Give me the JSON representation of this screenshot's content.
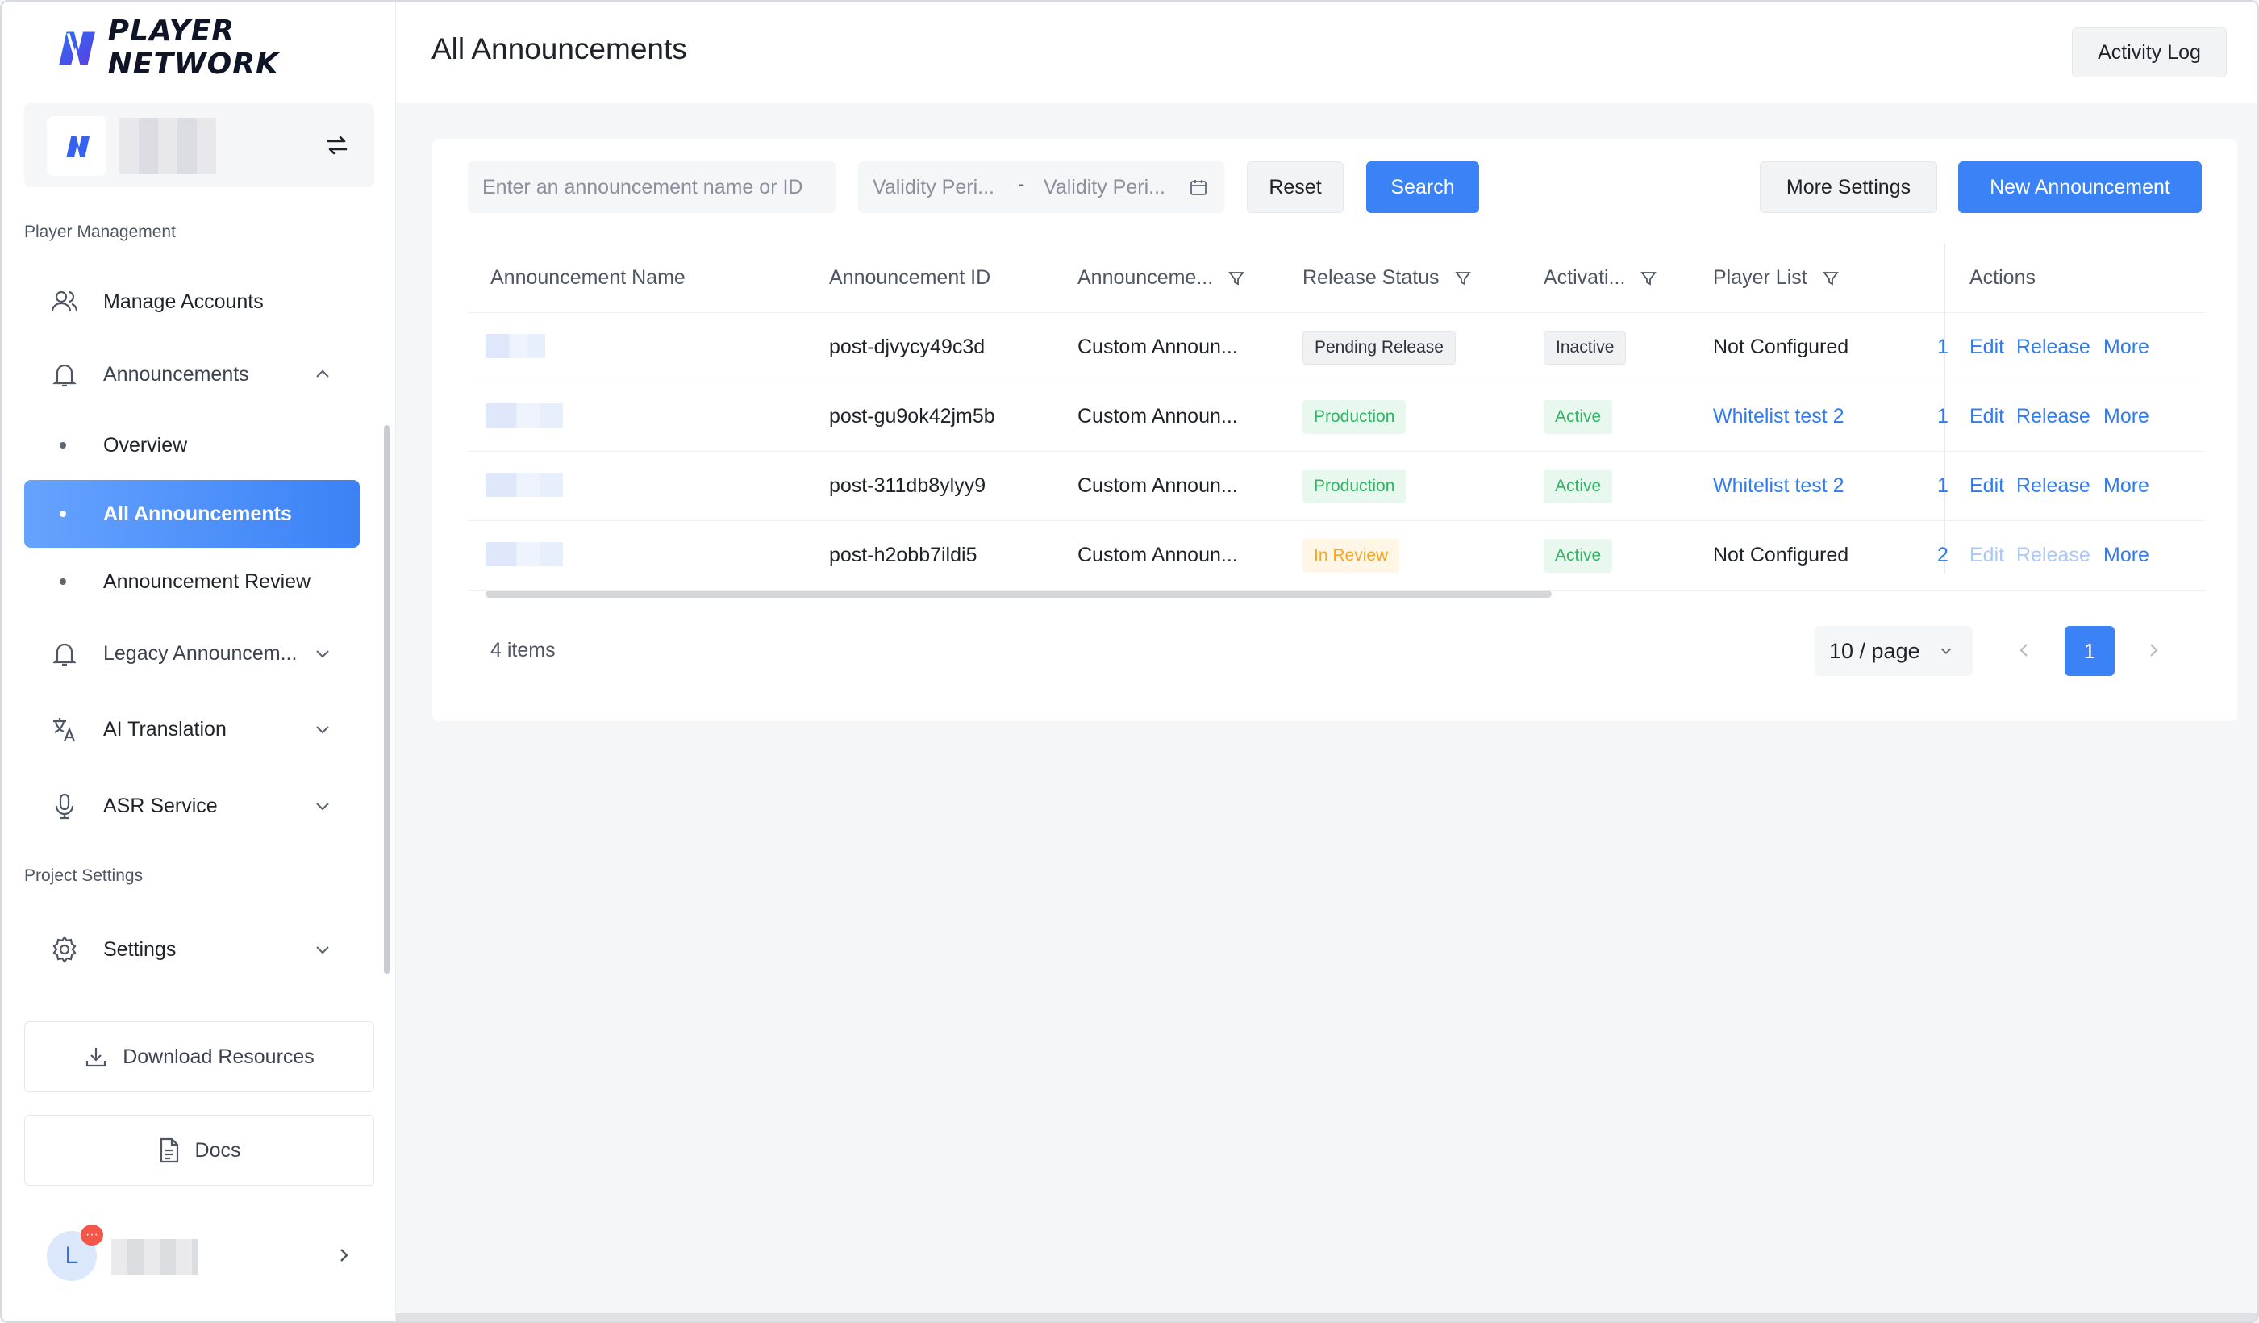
{
  "brand": {
    "name": "PLAYER NETWORK"
  },
  "sidebar": {
    "section_player": "Player Management",
    "section_project": "Project Settings",
    "items": {
      "manage_accounts": "Manage Accounts",
      "announcements": "Announcements",
      "overview": "Overview",
      "all_announcements": "All Announcements",
      "announcement_review": "Announcement Review",
      "legacy": "Legacy Announcem...",
      "ai_translation": "AI Translation",
      "asr_service": "ASR Service",
      "settings": "Settings"
    },
    "download_resources": "Download Resources",
    "docs": "Docs",
    "user_initial": "L",
    "user_badge": "···"
  },
  "header": {
    "title": "All Announcements",
    "activity_log": "Activity Log"
  },
  "toolbar": {
    "search_placeholder": "Enter an announcement name or ID",
    "validity_start_placeholder": "Validity Peri...",
    "validity_sep": "-",
    "validity_end_placeholder": "Validity Peri...",
    "reset": "Reset",
    "search": "Search",
    "more_settings": "More Settings",
    "new_announcement": "New Announcement"
  },
  "table": {
    "columns": {
      "name": "Announcement Name",
      "id": "Announcement ID",
      "type": "Announceme...",
      "release_status": "Release Status",
      "activation": "Activati...",
      "player_list": "Player List",
      "actions": "Actions"
    },
    "rows": [
      {
        "id": "post-djvycy49c3d",
        "type": "Custom Announ...",
        "release_status": "Pending Release",
        "release_color": "gray",
        "activation": "Inactive",
        "activation_color": "gray",
        "player_list": "Not Configured",
        "player_list_link": false,
        "frag": "1",
        "edit": "Edit",
        "release": "Release",
        "more": "More",
        "disabled": false
      },
      {
        "id": "post-gu9ok42jm5b",
        "type": "Custom Announ...",
        "release_status": "Production",
        "release_color": "green",
        "activation": "Active",
        "activation_color": "green",
        "player_list": "Whitelist test 2",
        "player_list_link": true,
        "frag": "1",
        "edit": "Edit",
        "release": "Release",
        "more": "More",
        "disabled": false
      },
      {
        "id": "post-311db8ylyy9",
        "type": "Custom Announ...",
        "release_status": "Production",
        "release_color": "green",
        "activation": "Active",
        "activation_color": "green",
        "player_list": "Whitelist test 2",
        "player_list_link": true,
        "frag": "1",
        "edit": "Edit",
        "release": "Release",
        "more": "More",
        "disabled": false
      },
      {
        "id": "post-h2obb7ildi5",
        "type": "Custom Announ...",
        "release_status": "In Review",
        "release_color": "orange",
        "activation": "Active",
        "activation_color": "green",
        "player_list": "Not Configured",
        "player_list_link": false,
        "frag": "2",
        "edit": "Edit",
        "release": "Release",
        "more": "More",
        "disabled": true
      }
    ]
  },
  "pagination": {
    "count": "4 items",
    "page_size": "10 / page",
    "current_page": "1"
  },
  "colors": {
    "accent": "#3b82f6",
    "green": "#2fb463",
    "orange": "#f5a623"
  }
}
